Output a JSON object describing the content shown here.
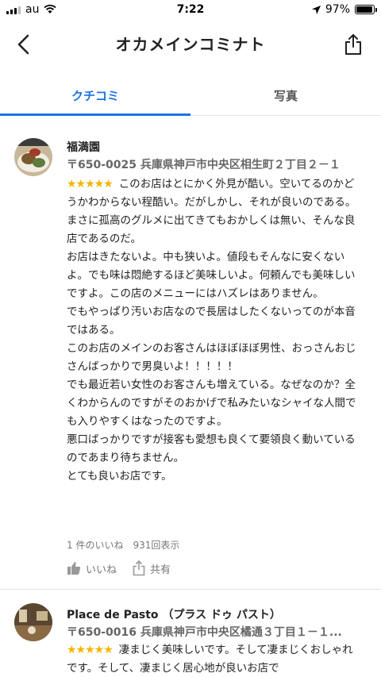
{
  "status_bar": {
    "carrier": "au",
    "time": "7:22",
    "battery": "97%",
    "battery_level": 0.97
  },
  "app_bar": {
    "title": "オカメインコミナト"
  },
  "tabs": [
    {
      "label": "クチコミ",
      "selected": true
    },
    {
      "label": "写真",
      "selected": false
    }
  ],
  "reviews": [
    {
      "name": "福満園",
      "address": "〒650-0025 兵庫県神戸市中央区相生町２丁目２－１",
      "stars": "★★★★★",
      "rating": 5,
      "first_line": "このお店はとにかく外見が酷い。空いてるのかどうかわからない程酷い。だがしかし、それが良いのである。",
      "lines": [
        "まさに孤高のグルメに出てきてもおかしくは無い、そんな良店であるのだ。",
        "お店はきたないよ。中も狭いよ。値段もそんなに安くないよ。でも味は悶絶するほど美味しいよ。何頼んでも美味しいですよ。この店のメニューにはハズレはありません。",
        "でもやっぱり汚いお店なので長居はしたくないってのが本音ではある。",
        "このお店のメインのお客さんはほぼほぼ男性、おっさんおじさんばっかりで男臭いよ！！！！！",
        "でも最近若い女性のお客さんも増えている。なぜなのか？全くわからんのですがそのおかげで私みたいなシャイな人間でも入りやすくはなったのですよ。",
        "悪口ばっかりですが接客も愛想も良くて要領良く動いているのであまり待ちません。",
        "とても良いお店です。"
      ],
      "likes": "1 件のいいね",
      "views": "931回表示",
      "like_label": "いいね",
      "share_label": "共有"
    },
    {
      "name": "Place de Pasto （プラス ドゥ パスト）",
      "address": "〒650-0016 兵庫県神戸市中央区橘通３丁目１－１...",
      "stars": "★★★★★",
      "rating": 5,
      "first_line": "凄まじく美味しいです。そして凄まじくおしゃれです。そして、凄まじく居心地が良いお店で"
    }
  ]
}
